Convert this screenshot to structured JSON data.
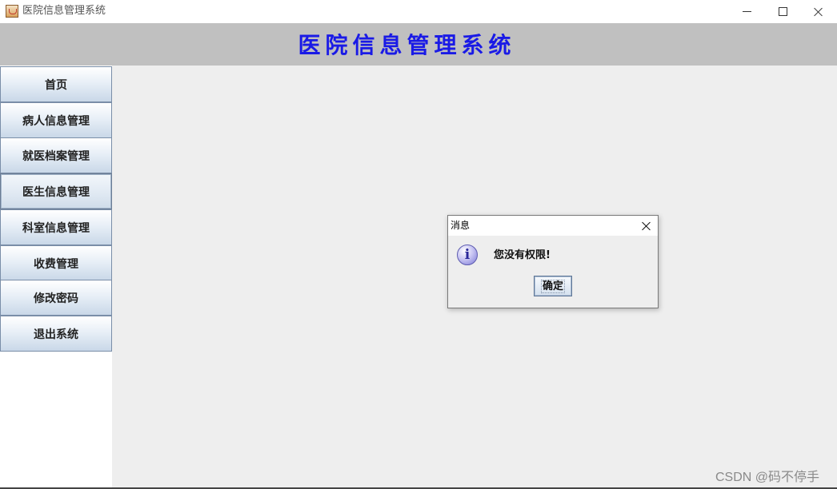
{
  "window": {
    "title": "医院信息管理系统",
    "app_icon": "java-cup-icon",
    "controls": [
      "minimize-icon",
      "maximize-icon",
      "close-icon"
    ]
  },
  "header": {
    "title": "医院信息管理系统",
    "title_color": "#1a1ae6",
    "background": "#c0c0c0"
  },
  "sidebar": {
    "items": [
      {
        "label": "首页"
      },
      {
        "label": "病人信息管理"
      },
      {
        "label": "就医档案管理"
      },
      {
        "label": "医生信息管理",
        "active": true
      },
      {
        "label": "科室信息管理"
      },
      {
        "label": "收费管理"
      },
      {
        "label": "修改密码"
      },
      {
        "label": "退出系统"
      }
    ]
  },
  "dialog": {
    "title": "消息",
    "icon": "info-icon",
    "icon_glyph": "i",
    "message": "您没有权限!",
    "ok_label": "确定"
  },
  "watermark": "CSDN @码不停手"
}
